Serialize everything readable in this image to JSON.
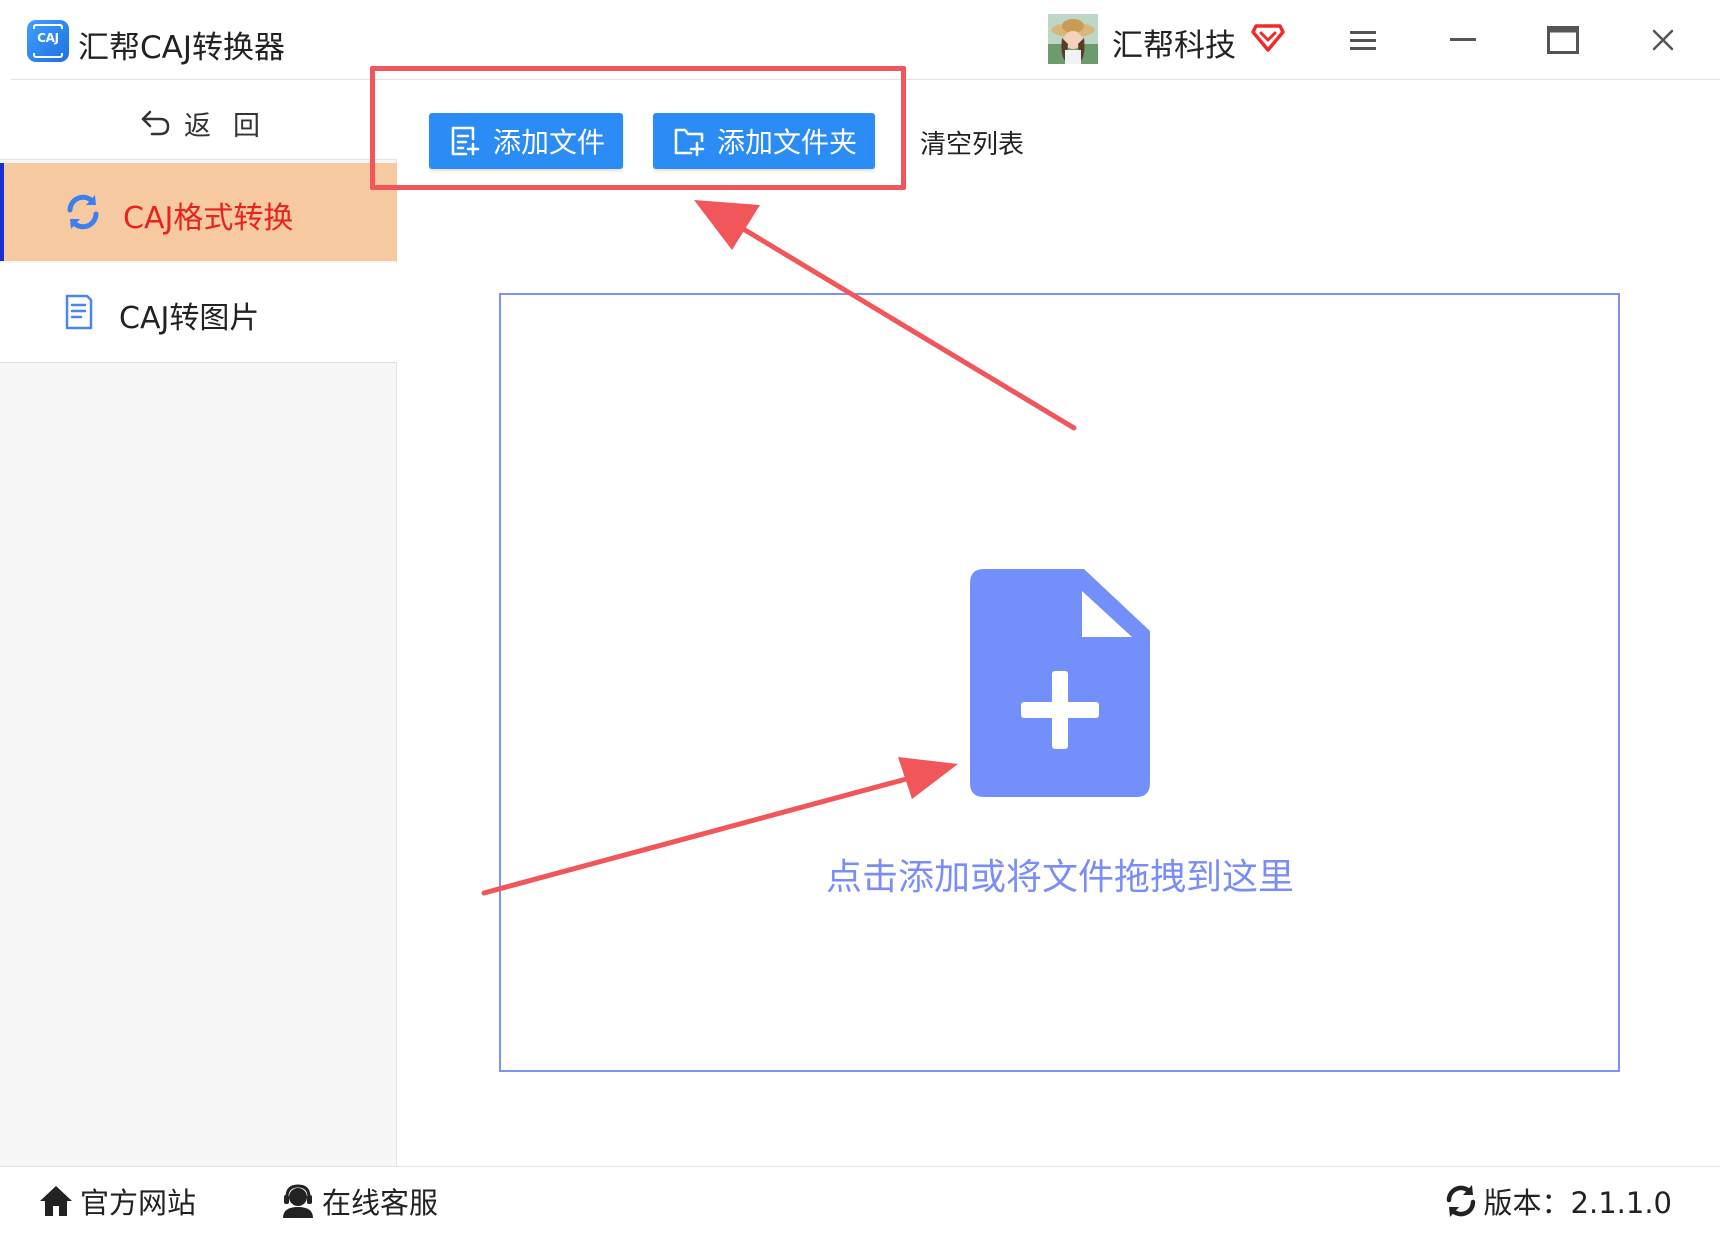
{
  "app": {
    "logo_text": "CAJ",
    "title": "汇帮CAJ转换器"
  },
  "user": {
    "name": "汇帮科技"
  },
  "window_controls": [
    "menu-icon",
    "minimize-icon",
    "maximize-icon",
    "close-icon"
  ],
  "sidebar": {
    "back_label": "返回",
    "items": [
      {
        "label": "CAJ格式转换",
        "icon": "refresh-icon",
        "active": true
      },
      {
        "label": "CAJ转图片",
        "icon": "document-icon",
        "active": false
      }
    ]
  },
  "toolbar": {
    "add_file_label": "添加文件",
    "add_folder_label": "添加文件夹",
    "clear_label": "清空列表"
  },
  "dropzone": {
    "hint": "点击添加或将文件拖拽到这里"
  },
  "footer": {
    "site_label": "官方网站",
    "service_label": "在线客服",
    "version_label": "版本：2.1.1.0"
  },
  "colors": {
    "primary": "#2a8cf4",
    "active_bg": "#f7c9a1",
    "active_text": "#e8231d",
    "dropzone_border": "#7c93f4",
    "annotation": "#f0565a"
  }
}
